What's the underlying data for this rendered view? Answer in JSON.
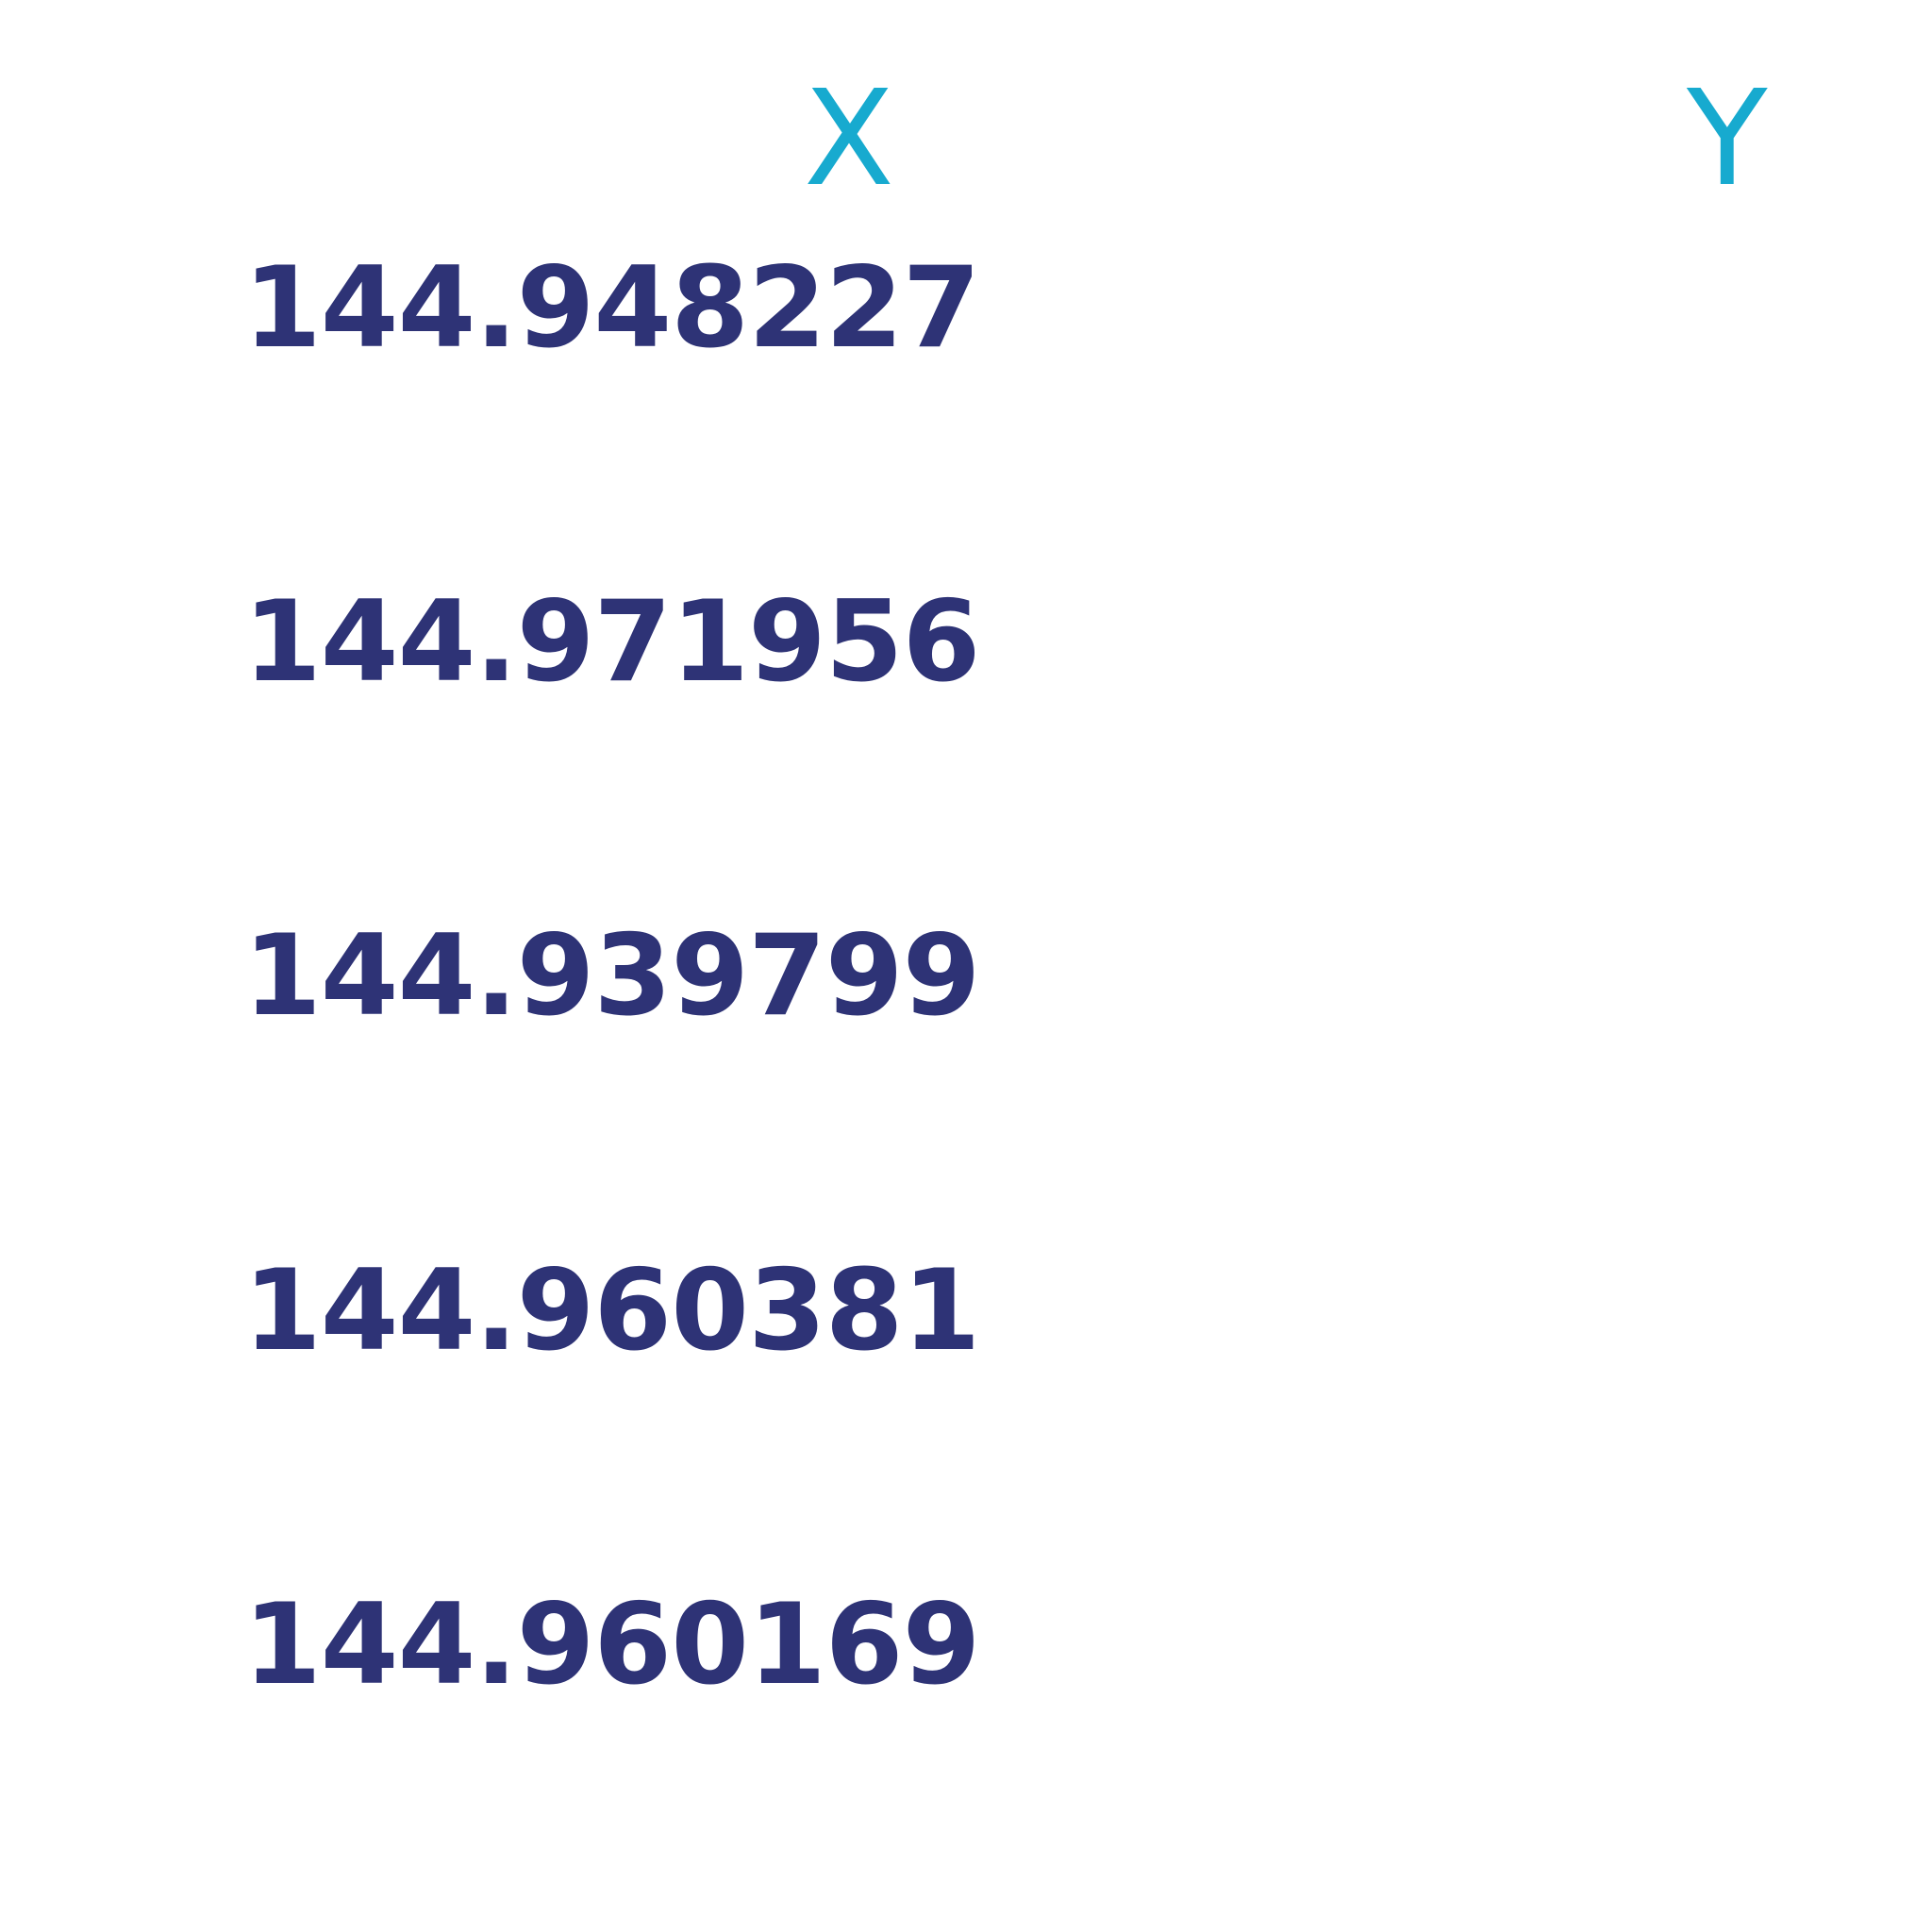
{
  "table": {
    "headers": {
      "x": "X",
      "y": "Y"
    },
    "rows": [
      {
        "x": "144.948227",
        "y": ""
      },
      {
        "x": "144.971956",
        "y": ""
      },
      {
        "x": "144.939799",
        "y": ""
      },
      {
        "x": "144.960381",
        "y": ""
      },
      {
        "x": "144.960169",
        "y": ""
      }
    ]
  },
  "colors": {
    "header": "#17aacf",
    "value": "#2e3376",
    "background": "#ffffff"
  }
}
